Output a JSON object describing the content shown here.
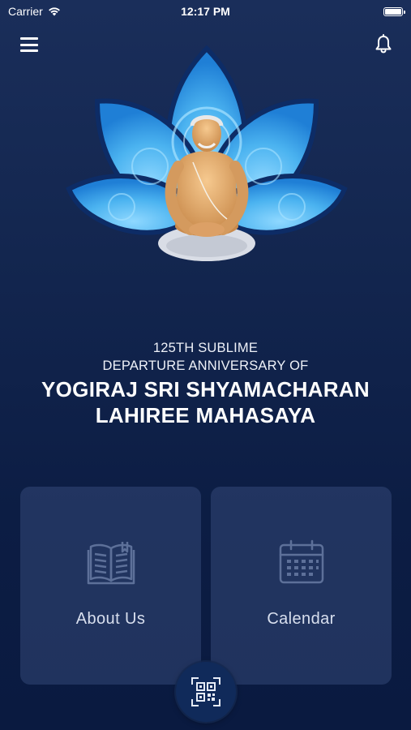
{
  "status_bar": {
    "carrier": "Carrier",
    "time": "12:17 PM"
  },
  "header": {
    "menu_icon": "hamburger-menu-icon",
    "notification_icon": "bell-icon"
  },
  "hero": {
    "image": "saint-meditating-on-blue-lotus"
  },
  "headline": {
    "line1": "125TH SUBLIME",
    "line2": "DEPARTURE ANNIVERSARY OF",
    "title_line1": "YOGIRAJ SRI SHYAMACHARAN",
    "title_line2": "LAHIREE MAHASAYA"
  },
  "cards": [
    {
      "label": "About Us",
      "icon": "open-book-icon"
    },
    {
      "label": "Calendar",
      "icon": "calendar-icon"
    }
  ],
  "fab": {
    "icon": "qr-code-scan-icon"
  },
  "colors": {
    "background_top": "#1a2e5a",
    "background_bottom": "#0a1a40",
    "card_bg": "#2a3f6e",
    "lotus_light": "#5cc0f5",
    "lotus_dark": "#1d6fc7"
  }
}
